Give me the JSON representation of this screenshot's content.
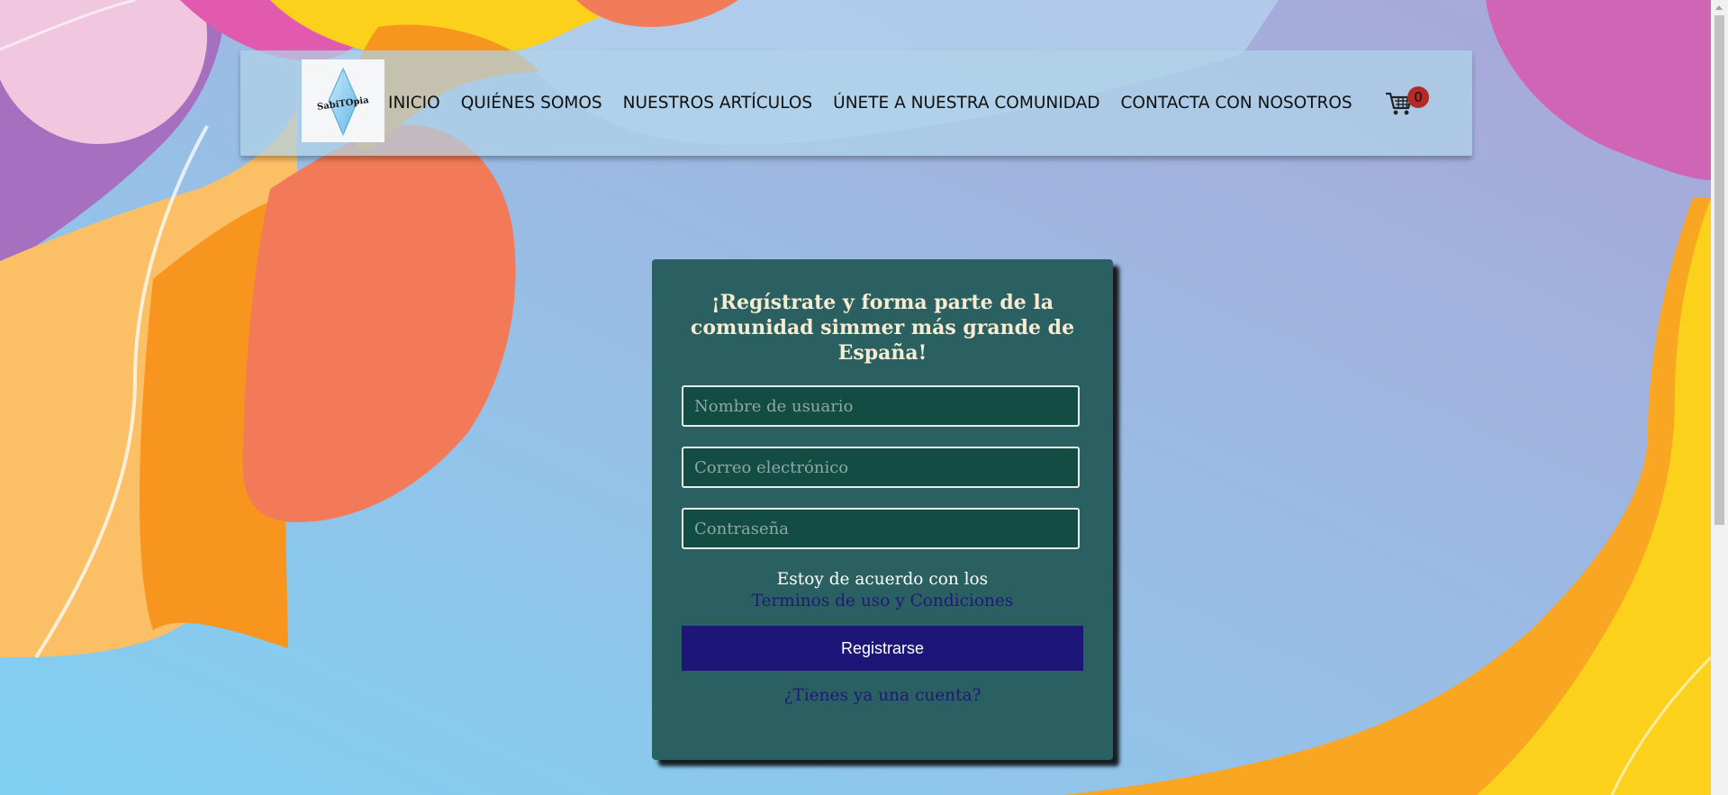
{
  "colors": {
    "navbar_bg": "#b0d2e8",
    "card_bg": "#2a6061",
    "field_bg": "#124c43",
    "title_color": "#f7ecd2",
    "button_bg": "#1e1578",
    "link_color": "#1e1a78",
    "badge_bg": "#b22b28"
  },
  "brand": {
    "logo_text": "SabiTOpia",
    "logo_icon": "plumbob-icon"
  },
  "nav": {
    "items": [
      {
        "label": "INICIO"
      },
      {
        "label": "QUIÉNES SOMOS"
      },
      {
        "label": "NUESTROS ARTÍCULOS"
      },
      {
        "label": "ÚNETE A NUESTRA COMUNIDAD"
      },
      {
        "label": "CONTACTA CON NOSOTROS"
      }
    ],
    "cart_icon": "shopping-cart-icon",
    "cart_count": "0"
  },
  "register": {
    "title": "¡Regístrate y forma parte de la comunidad simmer más grande de España!",
    "username_placeholder": "Nombre de usuario",
    "email_placeholder": "Correo electrónico",
    "password_placeholder": "Contraseña",
    "terms_text": "Estoy de acuerdo con los",
    "terms_link": "Terminos de uso y Condiciones",
    "submit_label": "Registrarse",
    "login_link": "¿Tienes ya una cuenta?"
  }
}
